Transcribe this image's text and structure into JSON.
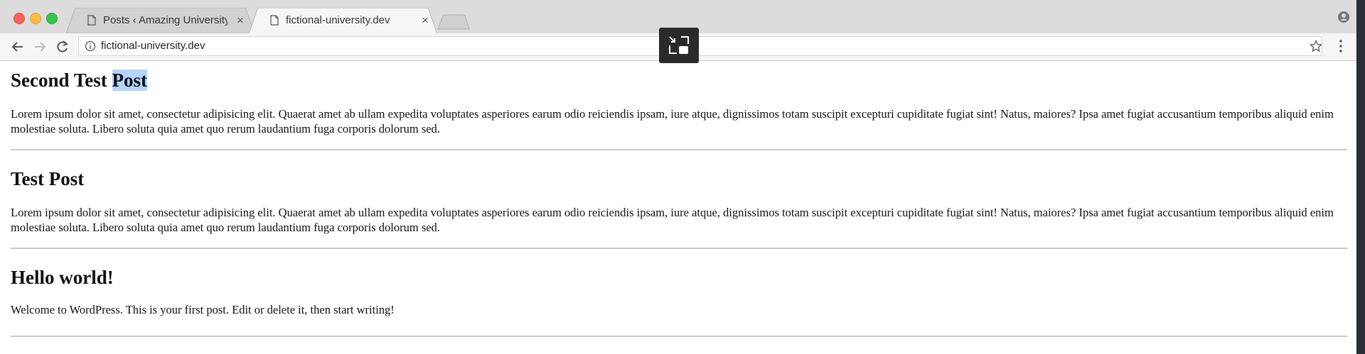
{
  "browser": {
    "tabs": [
      {
        "label": "Posts ‹ Amazing University —",
        "close": "×"
      },
      {
        "label": "fictional-university.dev",
        "close": "×"
      }
    ],
    "address_bar": {
      "url": "fictional-university.dev"
    }
  },
  "posts": [
    {
      "title_before": "Second Test ",
      "title_selected": "Post",
      "body": "Lorem ipsum dolor sit amet, consectetur adipisicing elit. Quaerat amet ab ullam expedita voluptates asperiores earum odio reiciendis ipsam, iure atque, dignissimos totam suscipit excepturi cupiditate fugiat sint! Natus, maiores? Ipsa amet fugiat accusantium temporibus aliquid enim molestiae soluta. Libero soluta quia amet quo rerum laudantium fuga corporis dolorum sed."
    },
    {
      "title": "Test Post",
      "body": "Lorem ipsum dolor sit amet, consectetur adipisicing elit. Quaerat amet ab ullam expedita voluptates asperiores earum odio reiciendis ipsam, iure atque, dignissimos totam suscipit excepturi cupiditate fugiat sint! Natus, maiores? Ipsa amet fugiat accusantium temporibus aliquid enim molestiae soluta. Libero soluta quia amet quo rerum laudantium fuga corporis dolorum sed."
    },
    {
      "title": "Hello world!",
      "body": "Welcome to WordPress. This is your first post. Edit or delete it, then start writing!"
    }
  ],
  "colors": {
    "selection": "#b3d4fc",
    "tabbar": "#dcdcdc",
    "divider": "#c9c9c9"
  },
  "icons": [
    "close-window-icon",
    "minimize-window-icon",
    "zoom-window-icon",
    "document-icon",
    "new-tab-icon",
    "profile-icon",
    "back-arrow-icon",
    "forward-arrow-icon",
    "reload-icon",
    "info-icon",
    "star-icon",
    "menu-dots-icon",
    "exit-fullscreen-icon"
  ]
}
